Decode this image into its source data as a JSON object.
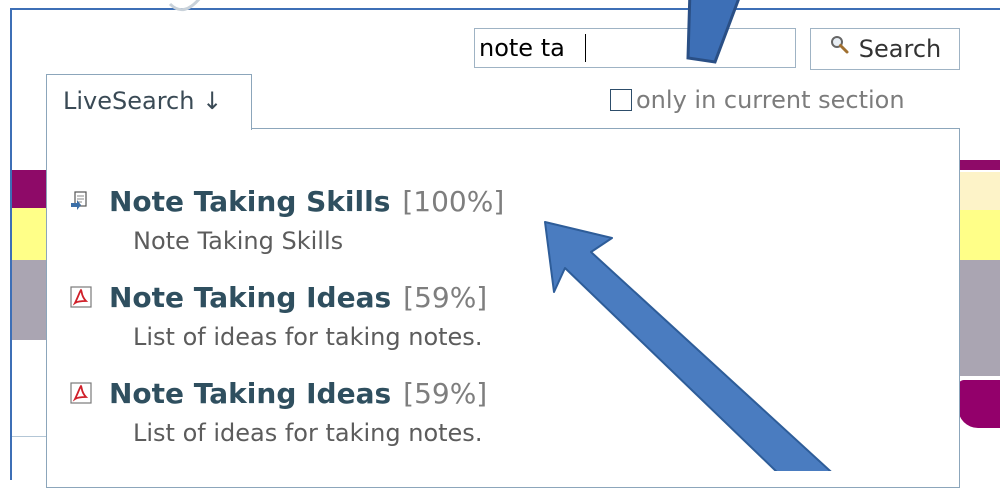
{
  "search": {
    "value": "note ta",
    "button_label": "Search"
  },
  "livesearch": {
    "tab_label": "LiveSearch ↓",
    "current_section_label": "only in current section"
  },
  "results": [
    {
      "title": "Note Taking Skills",
      "score": "[100%]",
      "description": "Note Taking Skills",
      "icon": "document-icon"
    },
    {
      "title": "Note Taking Ideas",
      "score": "[59%]",
      "description": "List of ideas for taking notes.",
      "icon": "pdf-icon"
    },
    {
      "title": "Note Taking Ideas",
      "score": "[59%]",
      "description": "List of ideas for taking notes.",
      "icon": "pdf-icon"
    }
  ],
  "colors": {
    "accent": "#3d6fb6",
    "link": "#2f4f5f",
    "border": "#8ca6bb"
  }
}
